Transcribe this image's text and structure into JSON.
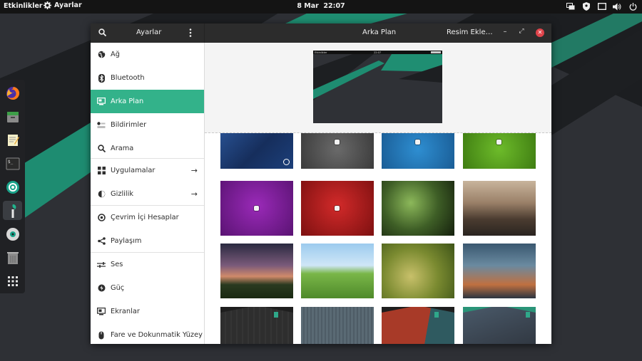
{
  "topbar": {
    "activities": "Etkinlikler",
    "app_menu": "Ayarlar",
    "date": "8 Mar",
    "time": "22:07"
  },
  "window": {
    "left_title": "Ayarlar",
    "center_title": "Arka Plan",
    "add_button": "Resim Ekle…",
    "min_label": "–",
    "max_label": "⤢",
    "close_label": "✕"
  },
  "sidebar": {
    "items": [
      {
        "label": "Ağ",
        "icon": "network-icon"
      },
      {
        "label": "Bluetooth",
        "icon": "bluetooth-icon"
      },
      {
        "label": "Arka Plan",
        "icon": "background-icon",
        "selected": true
      },
      {
        "label": "Bildirimler",
        "icon": "notifications-icon"
      },
      {
        "label": "Arama",
        "icon": "search-icon"
      },
      {
        "label": "Uygulamalar",
        "icon": "apps-icon",
        "arrow": "→"
      },
      {
        "label": "Gizlilik",
        "icon": "privacy-icon",
        "arrow": "→"
      },
      {
        "label": "Çevrim İçi Hesaplar",
        "icon": "online-accounts-icon"
      },
      {
        "label": "Paylaşım",
        "icon": "share-icon"
      },
      {
        "label": "Ses",
        "icon": "sound-icon"
      },
      {
        "label": "Güç",
        "icon": "power-icon"
      },
      {
        "label": "Ekranlar",
        "icon": "displays-icon"
      },
      {
        "label": "Fare ve Dokunmatik Yüzey",
        "icon": "mouse-icon"
      }
    ]
  },
  "preview": {
    "activities": "Etkinlikler",
    "time": "22:07"
  },
  "wallpapers": [
    {
      "name": "blue-geometric",
      "colors": [
        "#1c3f7a",
        "#13306a"
      ],
      "selected": true
    },
    {
      "name": "gray-logo",
      "colors": [
        "#6a6a6a",
        "#3b3b3b"
      ]
    },
    {
      "name": "blue-logo",
      "colors": [
        "#2e8ed1",
        "#1a5d96"
      ]
    },
    {
      "name": "green-logo",
      "colors": [
        "#6dbb2a",
        "#3f7d12"
      ]
    },
    {
      "name": "purple-logo",
      "colors": [
        "#9a2ab8",
        "#5a1373"
      ]
    },
    {
      "name": "red-logo",
      "colors": [
        "#d22a2a",
        "#7d1010"
      ]
    },
    {
      "name": "fern-leaves",
      "colors": [
        "#5e8a3a",
        "#1f2e14"
      ]
    },
    {
      "name": "mountains",
      "colors": [
        "#b4a08a",
        "#4b3c30"
      ]
    },
    {
      "name": "sunset-tree",
      "colors": [
        "#b56a6a",
        "#2a3a20"
      ]
    },
    {
      "name": "green-hills",
      "colors": [
        "#8ec0e6",
        "#4f8a2a"
      ]
    },
    {
      "name": "meadow-flower",
      "colors": [
        "#a8b04a",
        "#506a20"
      ]
    },
    {
      "name": "lightning-storm",
      "colors": [
        "#4a6f8c",
        "#c07040"
      ]
    },
    {
      "name": "dark-green-stripes",
      "colors": [
        "#3a3a3a",
        "#2c2c2c"
      ]
    },
    {
      "name": "slate-lines",
      "colors": [
        "#5e6e78",
        "#4b5962"
      ]
    },
    {
      "name": "red-teal-shapes",
      "colors": [
        "#a83a28",
        "#2f5a60"
      ]
    },
    {
      "name": "dark-mountain-lines",
      "colors": [
        "#4a5a6a",
        "#343c44"
      ]
    }
  ],
  "colors": {
    "accent": "#33b28a",
    "headerbar": "#2c2c2c",
    "topbar": "#141414",
    "close": "#e0444b"
  }
}
